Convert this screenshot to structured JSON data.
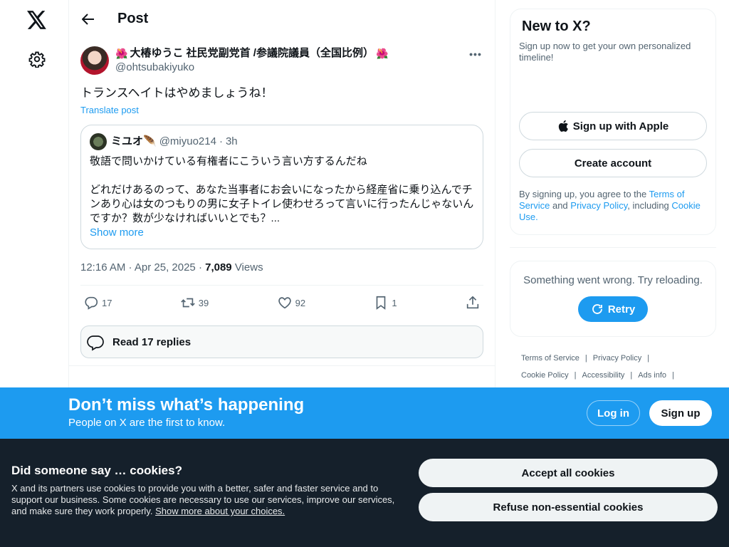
{
  "page": {
    "title": "Post"
  },
  "tweet": {
    "display_name": "大椿ゆうこ 社民党副党首 /参議院議員（全国比例）",
    "name_emoji": "🌺",
    "handle": "@ohtsubakiyuko",
    "text": "トランスヘイトはやめましょうね！",
    "translate_label": "Translate post",
    "timestamp": "12:16 AM · Apr 25, 2025 · ",
    "views_count": "7,089",
    "views_label": " Views",
    "stats": {
      "replies": "17",
      "reposts": "39",
      "likes": "92",
      "bookmarks": "1"
    },
    "read_replies_label": "Read 17 replies"
  },
  "quote": {
    "name": "ミユオ🪶",
    "handle": "@miyuo214",
    "time": "3h",
    "separator": "·",
    "text": "敬語で問いかけている有権者にこういう言い方するんだね\n\nどれだけあるのって、あなた当事者にお会いになったから経産省に乗り込んでチンあり心は女のつもりの男に女子トイレ使わせろって言いに行ったんじゃないんですか？数が少なければいいとでも？...",
    "show_more": "Show more"
  },
  "sidebar": {
    "new_title": "New to X?",
    "new_sub": "Sign up now to get your own personalized timeline!",
    "apple_label": "Sign up with Apple",
    "create_label": "Create account",
    "terms_prefix": "By signing up, you agree to the ",
    "terms_link": "Terms of Service",
    "terms_and": " and ",
    "privacy_link": "Privacy Policy",
    "terms_including": ", including ",
    "cookie_link": "Cookie Use.",
    "error_text": "Something went wrong. Try reloading.",
    "retry_label": "Retry",
    "footer": [
      "Terms of Service",
      "Privacy Policy",
      "Cookie Policy",
      "Accessibility",
      "Ads info"
    ],
    "footer_sep": "|"
  },
  "banner": {
    "title": "Don’t miss what’s happening",
    "sub": "People on X are the first to know.",
    "login": "Log in",
    "signup": "Sign up"
  },
  "cookies": {
    "title": "Did someone say … cookies?",
    "text": "X and its partners use cookies to provide you with a better, safer and faster service and to support our business. Some cookies are necessary to use our services, improve our services, and make sure they work properly. ",
    "link": "Show more about your choices.",
    "accept": "Accept all cookies",
    "refuse": "Refuse non-essential cookies"
  },
  "colors": {
    "accent": "#1d9bf0",
    "text": "#0f1419",
    "muted": "#536471",
    "cookie_bg": "#15202b"
  }
}
